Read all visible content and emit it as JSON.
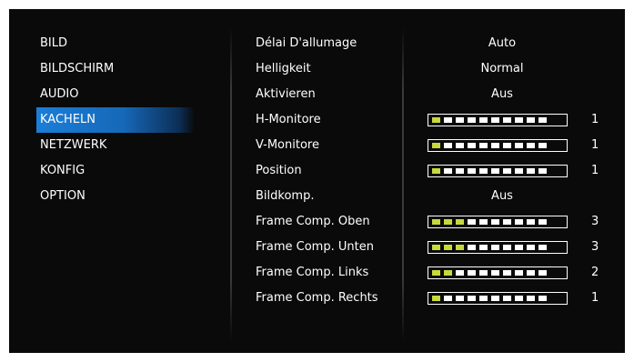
{
  "menu": {
    "items": [
      {
        "label": "BILD"
      },
      {
        "label": "BILDSCHIRM"
      },
      {
        "label": "AUDIO"
      },
      {
        "label": "KACHELN",
        "selected": true
      },
      {
        "label": "NETZWERK"
      },
      {
        "label": "KONFIG"
      },
      {
        "label": "OPTION"
      }
    ]
  },
  "settings": [
    {
      "label": "Délai D'allumage",
      "value": "Auto"
    },
    {
      "label": "Helligkeit",
      "value": "Normal"
    },
    {
      "label": "Aktivieren",
      "value": "Aus"
    },
    {
      "label": "H-Monitore",
      "slider": {
        "level": 1,
        "segments": 10
      },
      "number": "1"
    },
    {
      "label": "V-Monitore",
      "slider": {
        "level": 1,
        "segments": 10
      },
      "number": "1"
    },
    {
      "label": "Position",
      "slider": {
        "level": 1,
        "segments": 10
      },
      "number": "1"
    },
    {
      "label": "Bildkomp.",
      "value": "Aus"
    },
    {
      "label": "Frame Comp. Oben",
      "slider": {
        "level": 3,
        "segments": 10
      },
      "number": "3"
    },
    {
      "label": "Frame Comp. Unten",
      "slider": {
        "level": 3,
        "segments": 10
      },
      "number": "3"
    },
    {
      "label": "Frame Comp. Links",
      "slider": {
        "level": 2,
        "segments": 10
      },
      "number": "2"
    },
    {
      "label": "Frame Comp. Rechts",
      "slider": {
        "level": 1,
        "segments": 10
      },
      "number": "1"
    }
  ],
  "colors": {
    "background": "#0a0a0a",
    "selection": "#1a7ed8",
    "slider_active": "#c8d93a",
    "slider_inactive": "#ffffff"
  }
}
